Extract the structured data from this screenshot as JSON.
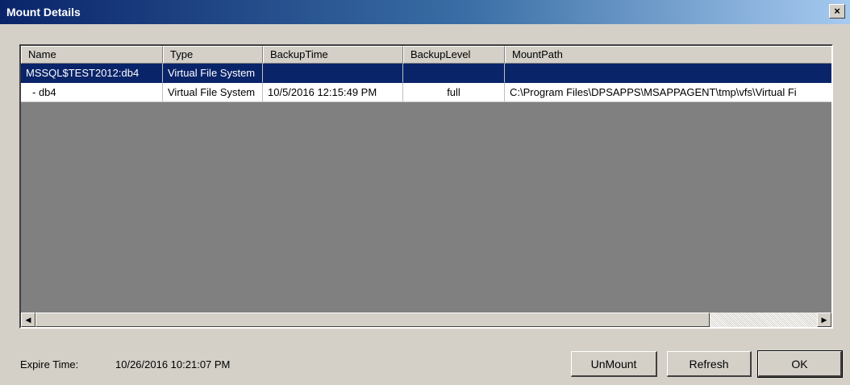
{
  "window": {
    "title": "Mount Details",
    "close_glyph": "×"
  },
  "table": {
    "columns": [
      "Name",
      "Type",
      "BackupTime",
      "BackupLevel",
      "MountPath"
    ],
    "rows": [
      {
        "name": "MSSQL$TEST2012:db4",
        "type": "Virtual File System",
        "backup_time": "",
        "backup_level": "",
        "mount_path": ""
      },
      {
        "name": "- db4",
        "type": "Virtual File System",
        "backup_time": "10/5/2016 12:15:49 PM",
        "backup_level": "full",
        "mount_path": "C:\\Program Files\\DPSAPPS\\MSAPPAGENT\\tmp\\vfs\\Virtual Fi"
      }
    ],
    "selected_row": 0
  },
  "scrollbar": {
    "left_icon": "arrow-left-icon",
    "right_icon": "arrow-right-icon",
    "left_glyph": "◀",
    "right_glyph": "▶"
  },
  "footer": {
    "expire_label": "Expire Time:",
    "expire_value": "10/26/2016 10:21:07 PM",
    "buttons": {
      "unmount": "UnMount",
      "refresh": "Refresh",
      "ok": "OK"
    }
  },
  "colors": {
    "selection": "#0a246a",
    "dialog_bg": "#d4d0c8",
    "list_bg": "#808080"
  }
}
